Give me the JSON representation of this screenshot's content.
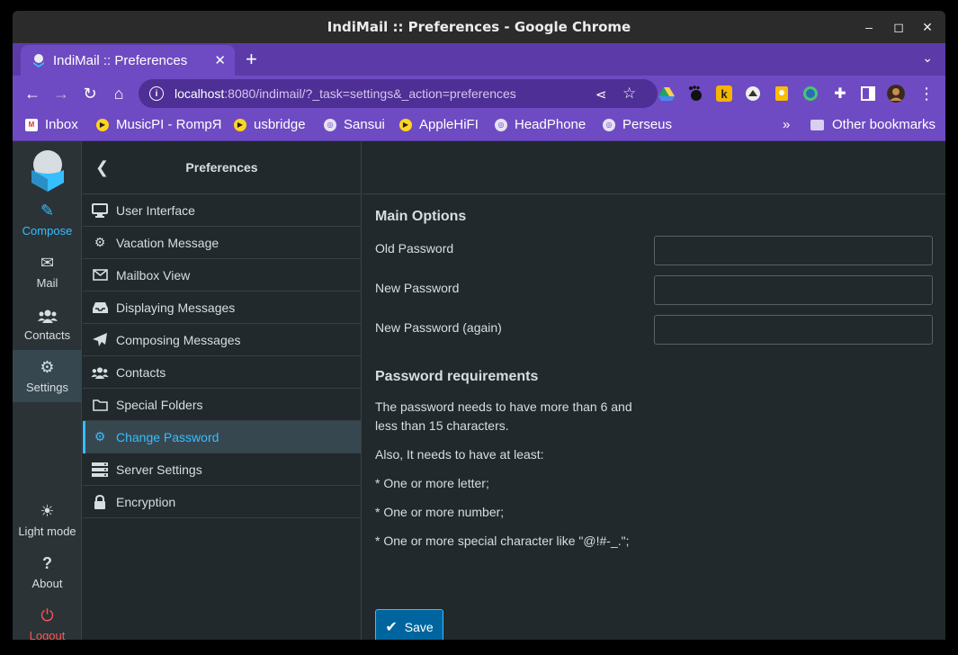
{
  "window": {
    "title": "IndiMail :: Preferences - Google Chrome",
    "minimize_glyph": "–",
    "maximize_glyph": "◻",
    "close_glyph": "✕"
  },
  "tab": {
    "title": "IndiMail :: Preferences",
    "close_glyph": "✕",
    "new_tab_glyph": "+",
    "menu_glyph": "⌄"
  },
  "toolbar": {
    "url_host": "localhost",
    "url_rest": ":8080/indimail/?_task=settings&_action=preferences",
    "back_glyph": "←",
    "forward_glyph": "→",
    "reload_glyph": "↻",
    "home_glyph": "⌂",
    "share_glyph": "⋖",
    "star_glyph": "☆",
    "menu_glyph": "⋮"
  },
  "bookmarks": {
    "items": [
      {
        "label": "Inbox",
        "icon": "gmail-icon"
      },
      {
        "label": "MusicPI - RompЯ",
        "icon": "play-icon"
      },
      {
        "label": "usbridge",
        "icon": "play-icon"
      },
      {
        "label": "Sansui",
        "icon": "globe-icon"
      },
      {
        "label": "AppleHiFI",
        "icon": "play-icon"
      },
      {
        "label": "HeadPhone",
        "icon": "globe-icon"
      },
      {
        "label": "Perseus",
        "icon": "globe-icon"
      }
    ],
    "overflow_glyph": "»",
    "other_label": "Other bookmarks"
  },
  "leftnav": {
    "compose": "Compose",
    "mail": "Mail",
    "contacts": "Contacts",
    "settings": "Settings",
    "light_mode": "Light mode",
    "about": "About",
    "logout": "Logout"
  },
  "settings": {
    "header": "Preferences",
    "items": [
      {
        "label": "User Interface",
        "icon": "monitor-icon"
      },
      {
        "label": "Vacation Message",
        "icon": "gear-icon"
      },
      {
        "label": "Mailbox View",
        "icon": "envelope-icon"
      },
      {
        "label": "Displaying Messages",
        "icon": "inbox-icon"
      },
      {
        "label": "Composing Messages",
        "icon": "paper-plane-icon"
      },
      {
        "label": "Contacts",
        "icon": "users-icon"
      },
      {
        "label": "Special Folders",
        "icon": "folder-icon"
      },
      {
        "label": "Change Password",
        "icon": "gear-icon"
      },
      {
        "label": "Server Settings",
        "icon": "server-icon"
      },
      {
        "label": "Encryption",
        "icon": "lock-icon"
      }
    ]
  },
  "form": {
    "main_options": "Main Options",
    "old_password": "Old Password",
    "new_password": "New Password",
    "new_password_again": "New Password (again)",
    "requirements_title": "Password requirements",
    "req_line1": "The password needs to have more than 6 and",
    "req_line2": "less than 15 characters.",
    "req_line3": "Also, It needs to have at least:",
    "req_line4": "* One or more letter;",
    "req_line5": "* One or more number;",
    "req_line6": "* One or more special character like \"@!#-_.\";",
    "save_label": "Save"
  },
  "colors": {
    "accent": "#37beff",
    "browser_purple": "#6e4bc2",
    "danger": "#ff5552",
    "save_button": "#00659e"
  }
}
